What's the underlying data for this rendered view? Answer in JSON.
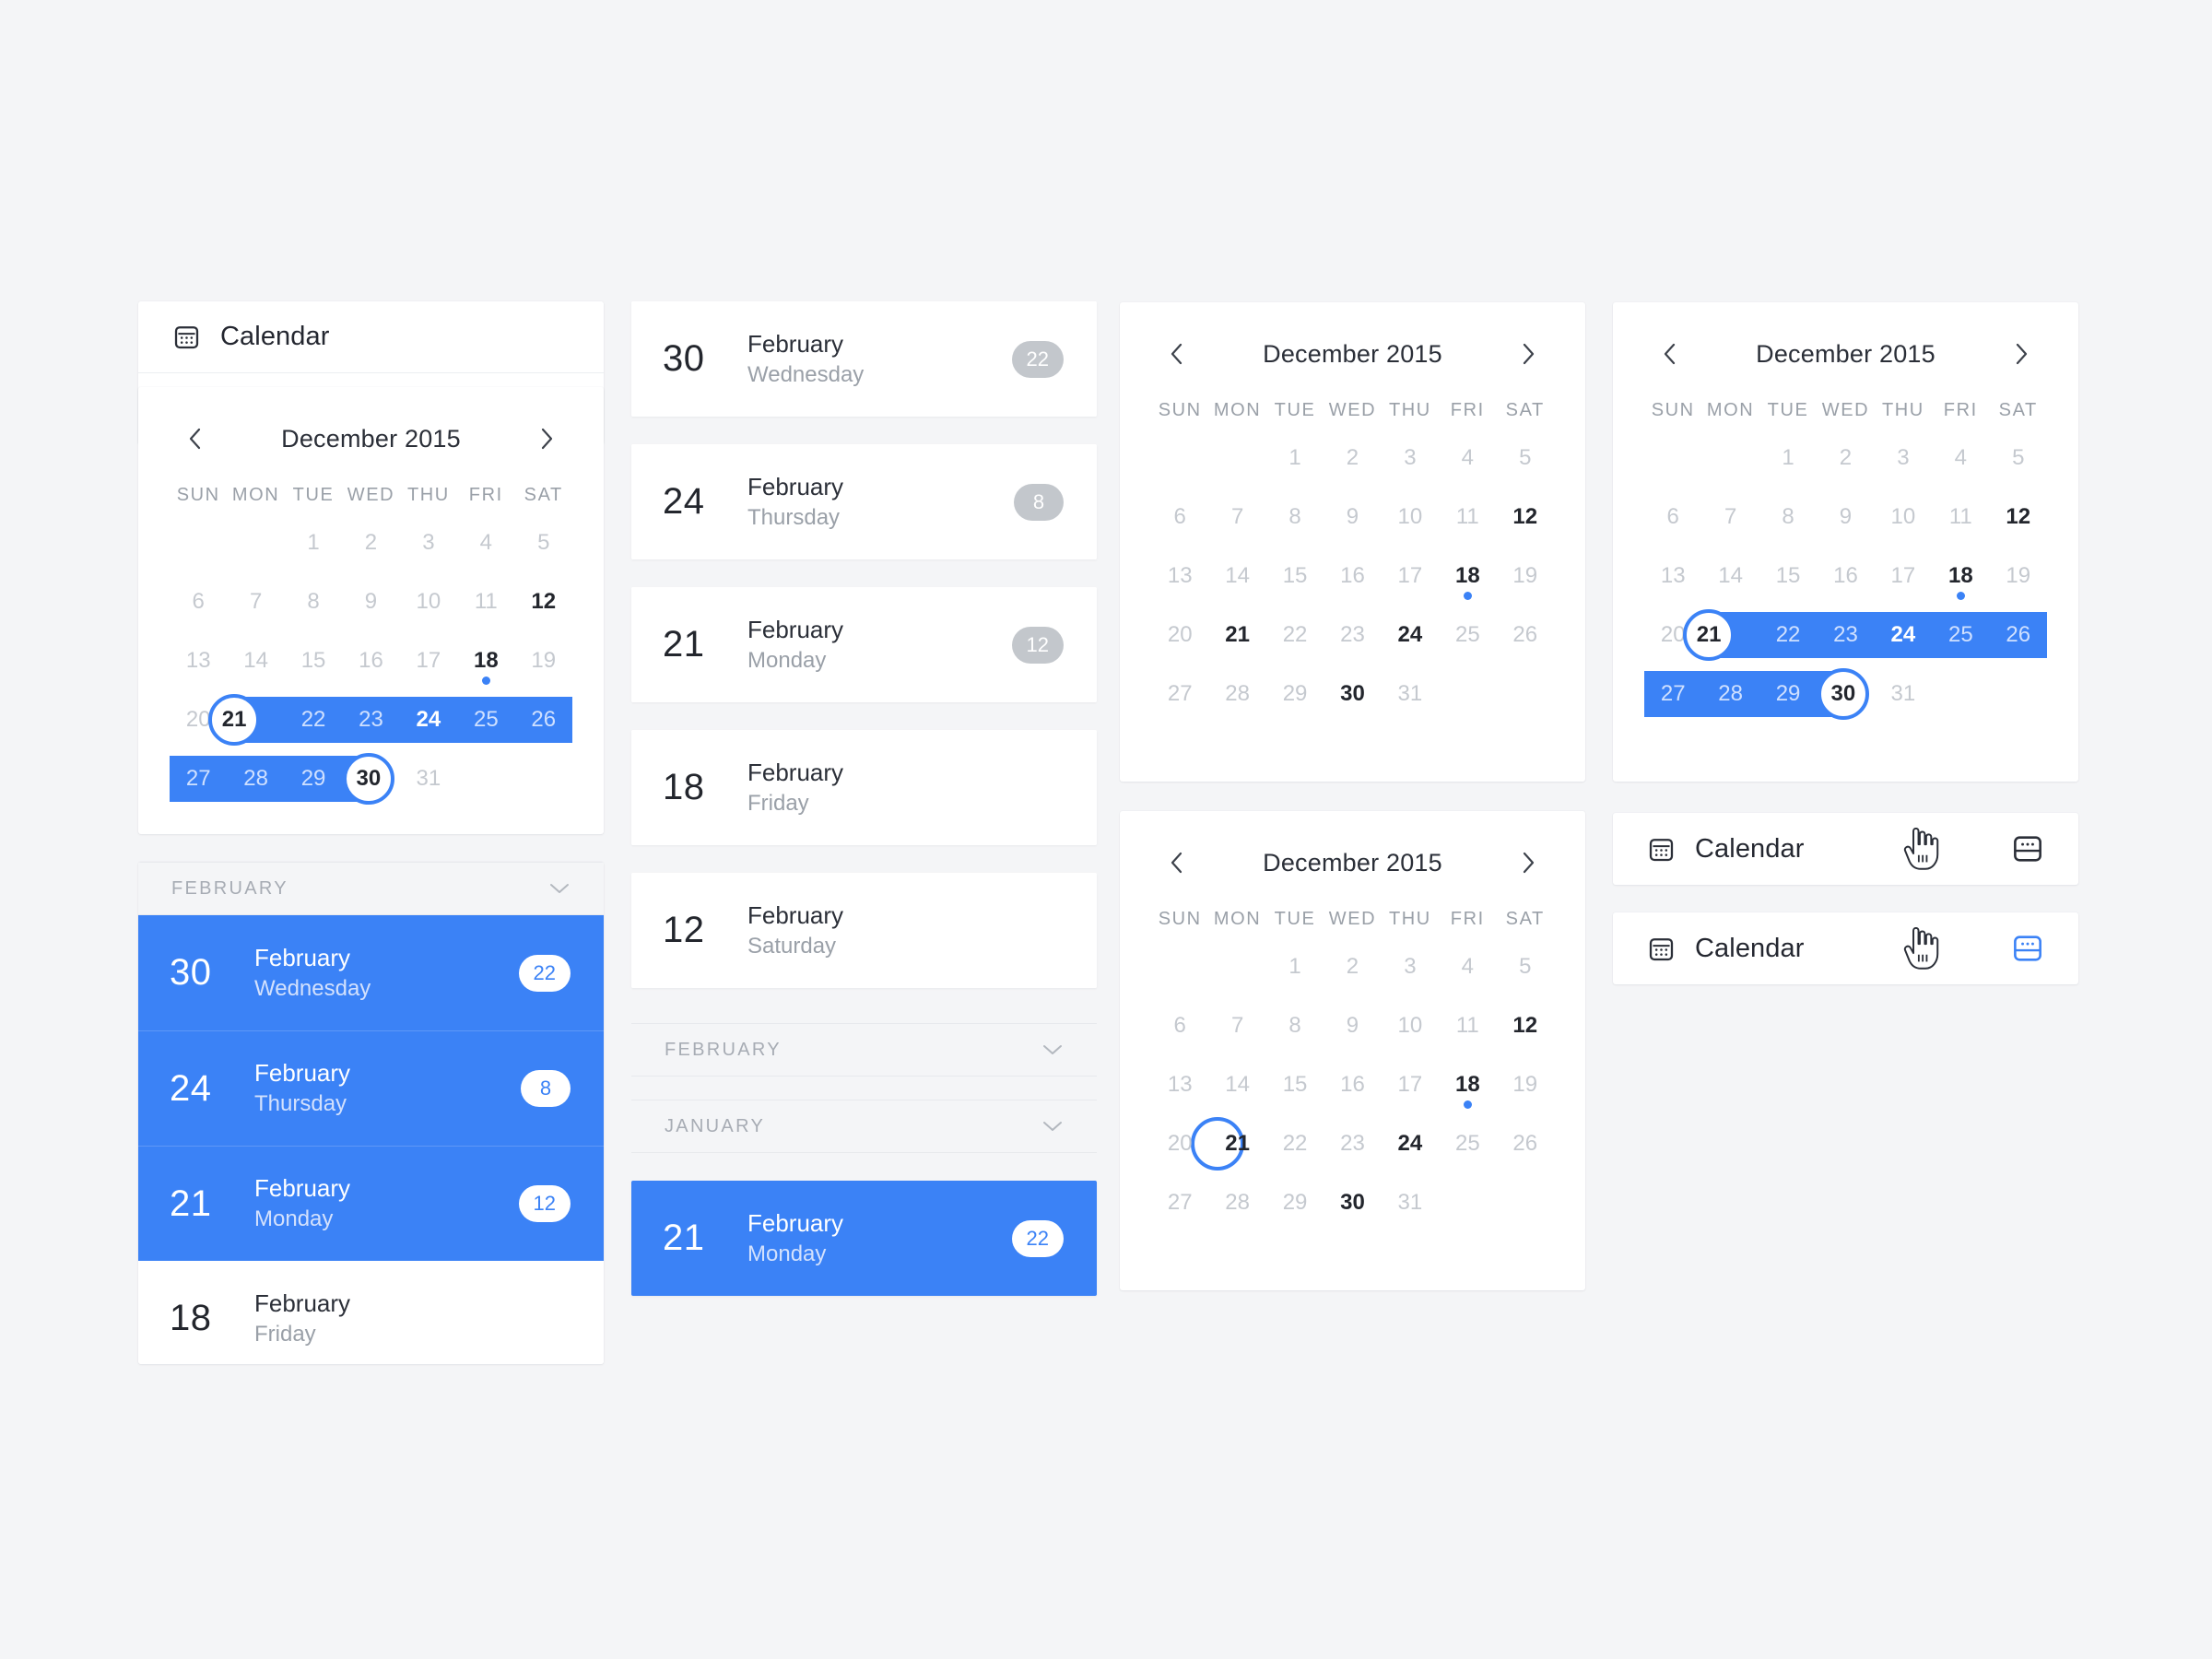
{
  "app": {
    "title": "Calendar",
    "icon": "calendar-icon"
  },
  "colors": {
    "accent": "#3b82f6",
    "background": "#f4f5f7",
    "card": "#ffffff",
    "text_primary": "#23262d",
    "text_muted": "#9aa0a8",
    "day_dim": "#c5c9cf",
    "badge_gray": "#c3c7cc",
    "event_dot": "#3b82f6"
  },
  "calendar": {
    "month_label": "December 2015",
    "prev_icon": "chevron-left-icon",
    "next_icon": "chevron-right-icon",
    "weekdays": [
      "SUN",
      "MON",
      "TUE",
      "WED",
      "THU",
      "FRI",
      "SAT"
    ],
    "weeks": [
      [
        "",
        "",
        "1",
        "2",
        "3",
        "4",
        "5"
      ],
      [
        "6",
        "7",
        "8",
        "9",
        "10",
        "11",
        "12"
      ],
      [
        "13",
        "14",
        "15",
        "16",
        "17",
        "18",
        "19"
      ],
      [
        "20",
        "21",
        "22",
        "23",
        "24",
        "25",
        "26"
      ],
      [
        "27",
        "28",
        "29",
        "30",
        "31",
        "",
        ""
      ]
    ],
    "bold_days": [
      "12",
      "18",
      "21",
      "24",
      "30"
    ],
    "event_dot_day": "18",
    "range_start": "21",
    "range_end": "30",
    "single_selected_day": "21"
  },
  "day_list": {
    "section_february": "FEBRUARY",
    "section_january": "JANUARY",
    "chevron_icon": "chevron-down-icon",
    "items": [
      {
        "day": "30",
        "month": "February",
        "weekday": "Wednesday",
        "count": "22",
        "selected": true
      },
      {
        "day": "24",
        "month": "February",
        "weekday": "Thursday",
        "count": "8",
        "selected": true
      },
      {
        "day": "21",
        "month": "February",
        "weekday": "Monday",
        "count": "12",
        "selected": true
      },
      {
        "day": "18",
        "month": "February",
        "weekday": "Friday",
        "count": "",
        "selected": false
      }
    ],
    "items_plain": [
      {
        "day": "30",
        "month": "February",
        "weekday": "Wednesday",
        "count": "22"
      },
      {
        "day": "24",
        "month": "February",
        "weekday": "Thursday",
        "count": "8"
      },
      {
        "day": "21",
        "month": "February",
        "weekday": "Monday",
        "count": "12"
      },
      {
        "day": "18",
        "month": "February",
        "weekday": "Friday",
        "count": ""
      },
      {
        "day": "12",
        "month": "February",
        "weekday": "Saturday",
        "count": ""
      }
    ],
    "highlighted_item": {
      "day": "21",
      "month": "February",
      "weekday": "Monday",
      "count": "22"
    }
  },
  "header_states": [
    {
      "title": "Calendar",
      "cursor": "hand-pointer-cursor",
      "toggle_icon": "split-view-icon",
      "toggle_active": false
    },
    {
      "title": "Calendar",
      "cursor": "hand-pointer-cursor",
      "toggle_icon": "split-view-icon",
      "toggle_active": true
    }
  ]
}
